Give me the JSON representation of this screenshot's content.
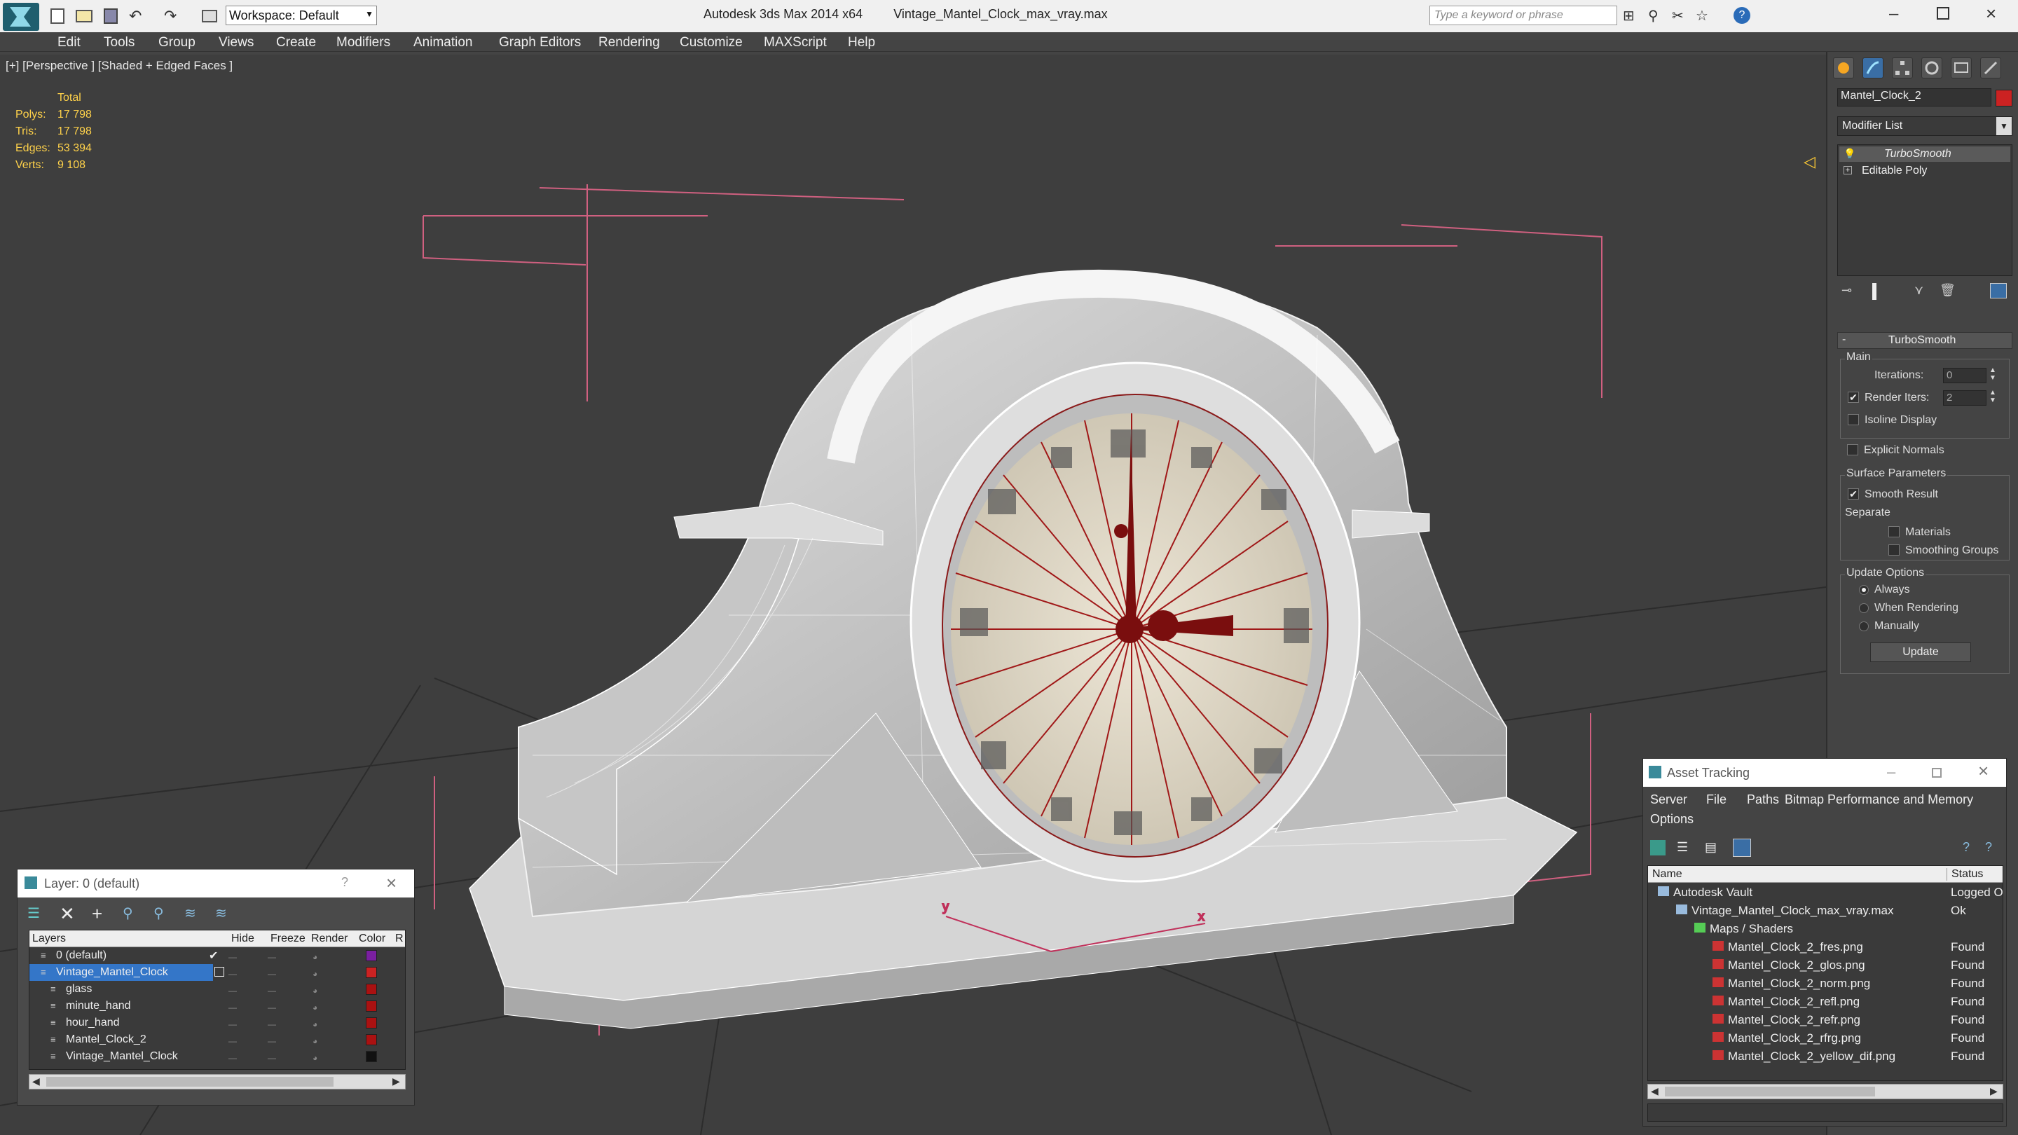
{
  "app": {
    "title": "Autodesk 3ds Max  2014 x64",
    "file": "Vintage_Mantel_Clock_max_vray.max",
    "workspace": "Workspace: Default",
    "search_placeholder": "Type a keyword or phrase"
  },
  "menu": [
    "Edit",
    "Tools",
    "Group",
    "Views",
    "Create",
    "Modifiers",
    "Animation",
    "Graph Editors",
    "Rendering",
    "Customize",
    "MAXScript",
    "Help"
  ],
  "viewport": {
    "label": "[+] [Perspective ] [Shaded + Edged Faces ]",
    "stats_header": "Total",
    "stats": [
      {
        "k": "Polys:",
        "v": "17 798"
      },
      {
        "k": "Tris:",
        "v": "17 798"
      },
      {
        "k": "Edges:",
        "v": "53 394"
      },
      {
        "k": "Verts:",
        "v": "9 108"
      }
    ]
  },
  "cmd": {
    "object_name": "Mantel_Clock_2",
    "object_color": "#cc2222",
    "modifier_list": "Modifier List",
    "stack": [
      "TurboSmooth",
      "Editable Poly"
    ],
    "rollout_title": "TurboSmooth",
    "main_label": "Main",
    "iterations_label": "Iterations:",
    "iterations_value": "0",
    "render_iters_label": "Render Iters:",
    "render_iters_value": "2",
    "isoline": "Isoline Display",
    "explicit": "Explicit Normals",
    "surface_params": "Surface Parameters",
    "smooth_result": "Smooth Result",
    "separate": "Separate",
    "materials": "Materials",
    "smoothing_groups": "Smoothing Groups",
    "update_options": "Update Options",
    "always": "Always",
    "when_rendering": "When Rendering",
    "manually": "Manually",
    "update_btn": "Update",
    "render_iters_checked": true,
    "smooth_result_checked": true
  },
  "layers": {
    "title": "Layer: 0 (default)",
    "help": "?",
    "cols": [
      "Layers",
      "Hide",
      "Freeze",
      "Render",
      "Color",
      "R"
    ],
    "rows": [
      {
        "name": "0 (default)",
        "color": "#7a1fa0",
        "indent": 1
      },
      {
        "name": "Vintage_Mantel_Clock",
        "color": "#cc2222",
        "indent": 1
      },
      {
        "name": "glass",
        "color": "#aa1111",
        "indent": 2
      },
      {
        "name": "minute_hand",
        "color": "#aa1111",
        "indent": 2
      },
      {
        "name": "hour_hand",
        "color": "#aa1111",
        "indent": 2
      },
      {
        "name": "Mantel_Clock_2",
        "color": "#aa1111",
        "indent": 2
      },
      {
        "name": "Vintage_Mantel_Clock",
        "color": "#111111",
        "indent": 2
      }
    ]
  },
  "assets": {
    "title": "Asset Tracking",
    "menu": [
      "Server",
      "File",
      "Paths",
      "Bitmap Performance and Memory"
    ],
    "menu2": "Options",
    "cols": [
      "Name",
      "Status"
    ],
    "rows": [
      {
        "name": "Autodesk Vault",
        "status": "Logged Ou",
        "level": 0
      },
      {
        "name": "Vintage_Mantel_Clock_max_vray.max",
        "status": "Ok",
        "level": 1
      },
      {
        "name": "Maps / Shaders",
        "status": "",
        "level": 2
      },
      {
        "name": "Mantel_Clock_2_fres.png",
        "status": "Found",
        "level": 3
      },
      {
        "name": "Mantel_Clock_2_glos.png",
        "status": "Found",
        "level": 3
      },
      {
        "name": "Mantel_Clock_2_norm.png",
        "status": "Found",
        "level": 3
      },
      {
        "name": "Mantel_Clock_2_refl.png",
        "status": "Found",
        "level": 3
      },
      {
        "name": "Mantel_Clock_2_refr.png",
        "status": "Found",
        "level": 3
      },
      {
        "name": "Mantel_Clock_2_rfrg.png",
        "status": "Found",
        "level": 3
      },
      {
        "name": "Mantel_Clock_2_yellow_dif.png",
        "status": "Found",
        "level": 3
      }
    ]
  }
}
